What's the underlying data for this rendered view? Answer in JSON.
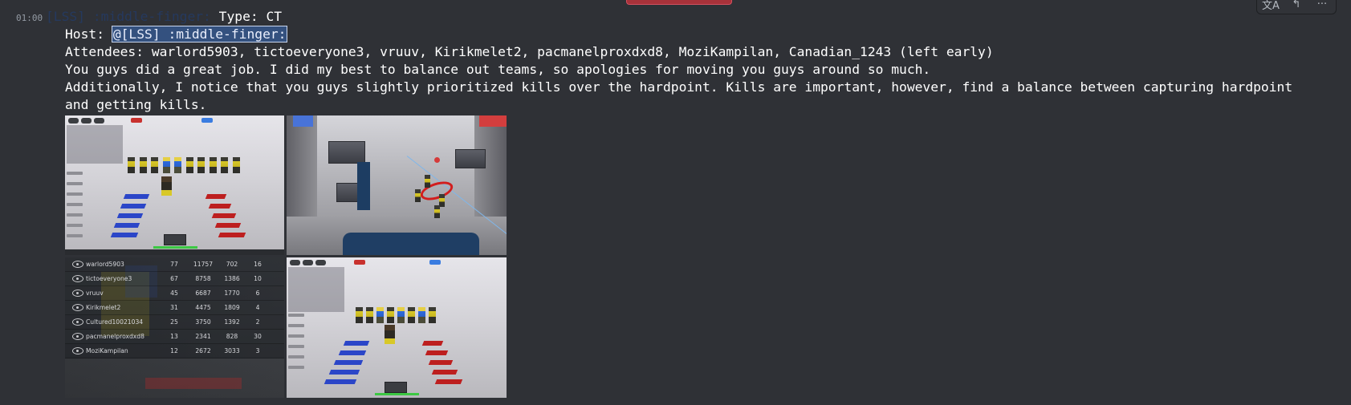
{
  "message": {
    "timestamp": "01:00",
    "author_mention": "[LSS] :middle-finger:",
    "type_line": " Type: CT",
    "host_label": "Host: ",
    "host_mention": "@[LSS] :middle-finger:",
    "attendees": "Attendees: warlord5903, tictoeveryone3, vruuv, Kirikmelet2, pacmanelproxdxd8, MoziKampilan, Canadian_1243 (left early)",
    "line1": "You guys did a great job. I did my best to balance out teams, so apologies for moving you guys around so much.",
    "line2": "Additionally, I notice that you guys slightly prioritized kills over the hardpoint. Kills are important, however, find a balance between capturing hardpoint and getting kills."
  },
  "toolbar": {
    "icons": [
      "translate-icon",
      "reply-icon",
      "more-icon"
    ],
    "translate_glyph": "文A",
    "reply_glyph": "↰",
    "more_glyph": "···"
  },
  "leaderboard": {
    "rows": [
      {
        "name": "warlord5903",
        "c1": "77",
        "c2": "11757",
        "c3": "702",
        "c4": "16"
      },
      {
        "name": "tictoeveryone3",
        "c1": "67",
        "c2": "8758",
        "c3": "1386",
        "c4": "10"
      },
      {
        "name": "vruuv",
        "c1": "45",
        "c2": "6687",
        "c3": "1770",
        "c4": "6"
      },
      {
        "name": "Kirikmelet2",
        "c1": "31",
        "c2": "4475",
        "c3": "1809",
        "c4": "4"
      },
      {
        "name": "Cultured10021034",
        "c1": "25",
        "c2": "3750",
        "c3": "1392",
        "c4": "2"
      },
      {
        "name": "pacmanelproxdxd8",
        "c1": "13",
        "c2": "2341",
        "c3": "828",
        "c4": "30"
      },
      {
        "name": "MoziKampilan",
        "c1": "12",
        "c2": "2672",
        "c3": "3033",
        "c4": "3"
      }
    ]
  },
  "colors": {
    "background": "#2f3136",
    "mention_faded": "#25395e",
    "mention_highlight": "#34517f",
    "red_team": "#bd1f1f",
    "blue_team": "#2b46c8"
  }
}
